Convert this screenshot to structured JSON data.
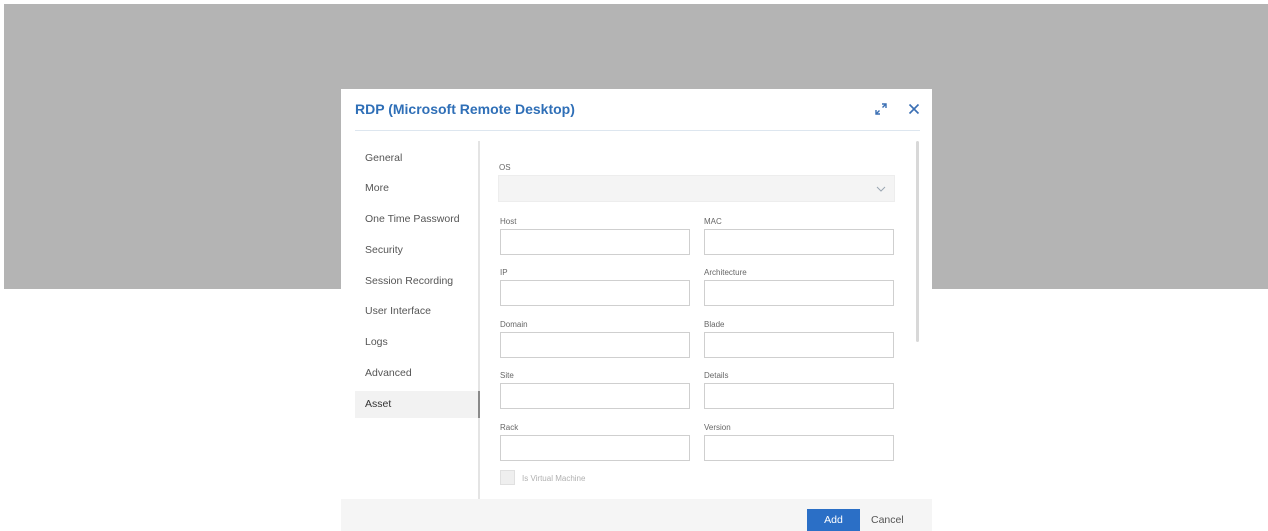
{
  "dialog": {
    "title": "RDP (Microsoft Remote Desktop)",
    "expand_icon": "expand-icon",
    "close_icon": "close-icon"
  },
  "sidebar": {
    "items": [
      {
        "label": "General"
      },
      {
        "label": "More"
      },
      {
        "label": "One Time Password"
      },
      {
        "label": "Security"
      },
      {
        "label": "Session Recording"
      },
      {
        "label": "User Interface"
      },
      {
        "label": "Logs"
      },
      {
        "label": "Advanced"
      },
      {
        "label": "Asset",
        "active": true
      }
    ]
  },
  "form": {
    "os": {
      "label": "OS",
      "value": ""
    },
    "host": {
      "label": "Host",
      "value": ""
    },
    "mac": {
      "label": "MAC",
      "value": ""
    },
    "ip": {
      "label": "IP",
      "value": ""
    },
    "architecture": {
      "label": "Architecture",
      "value": ""
    },
    "domain": {
      "label": "Domain",
      "value": ""
    },
    "blade": {
      "label": "Blade",
      "value": ""
    },
    "site": {
      "label": "Site",
      "value": ""
    },
    "details": {
      "label": "Details",
      "value": ""
    },
    "rack": {
      "label": "Rack",
      "value": ""
    },
    "version": {
      "label": "Version",
      "value": ""
    },
    "is_virtual_machine": {
      "label": "Is Virtual Machine",
      "checked": false
    }
  },
  "footer": {
    "add_label": "Add",
    "cancel_label": "Cancel"
  },
  "colors": {
    "accent": "#2b6fc6",
    "title": "#2f6fb7",
    "backdrop": "#b4b4b4"
  }
}
